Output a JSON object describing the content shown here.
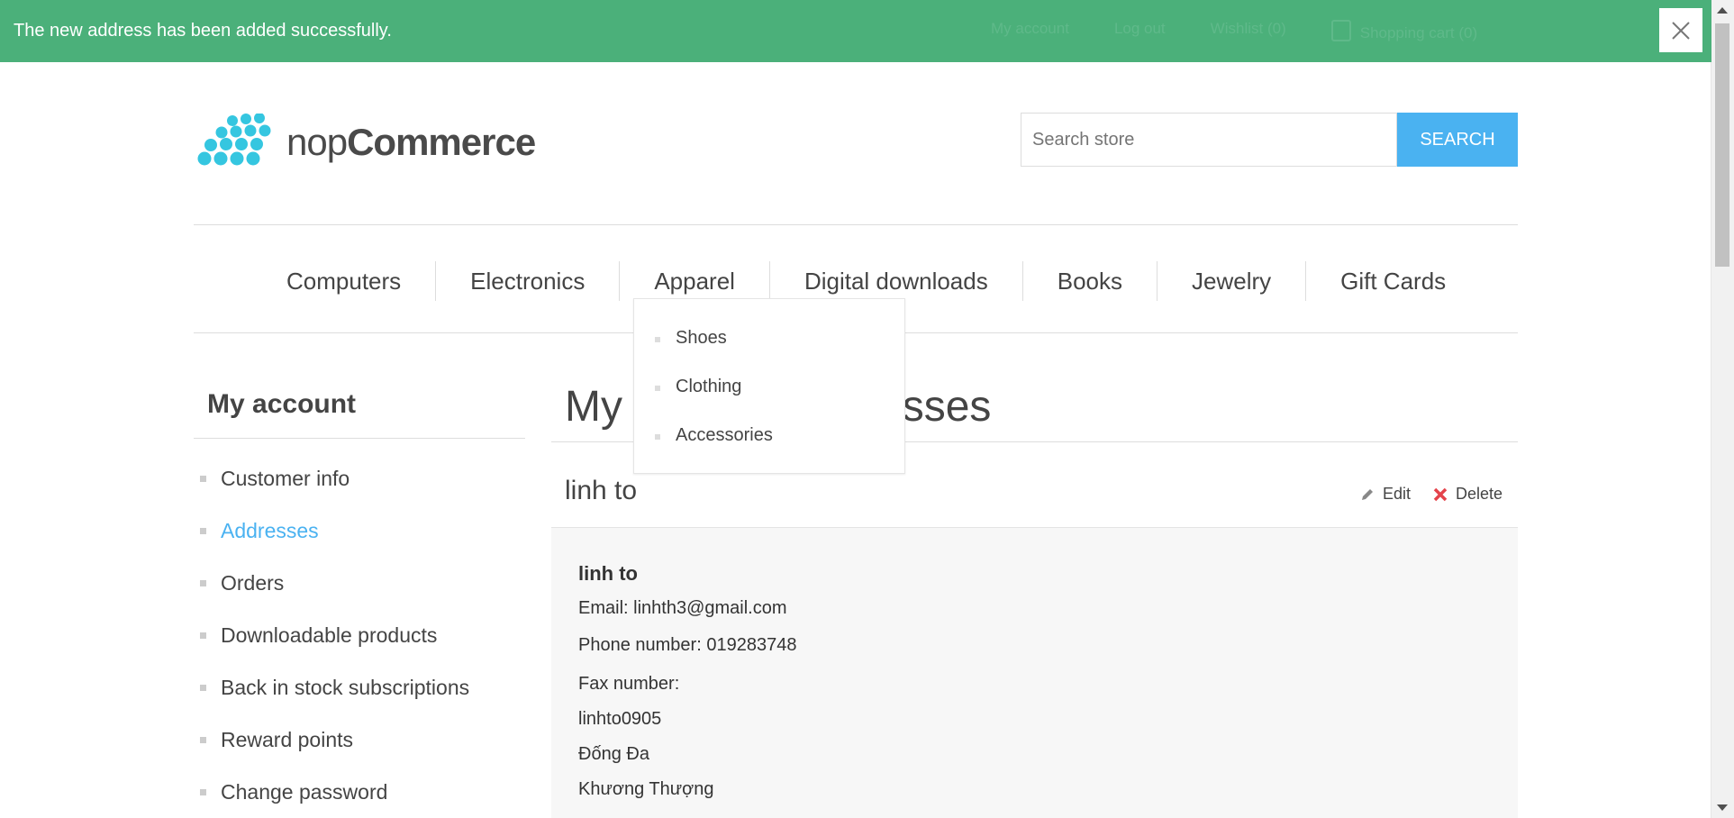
{
  "notification": {
    "message": "The new address has been added successfully."
  },
  "header_links": {
    "my_account": "My account",
    "logout": "Log out",
    "wishlist": "Wishlist (0)",
    "cart": "Shopping cart (0)"
  },
  "logo": {
    "prefix": "nop",
    "suffix": "Commerce"
  },
  "search": {
    "placeholder": "Search store",
    "button": "SEARCH"
  },
  "menu": [
    "Computers",
    "Electronics",
    "Apparel",
    "Digital downloads",
    "Books",
    "Jewelry",
    "Gift Cards"
  ],
  "apparel_dropdown": [
    "Shoes",
    "Clothing",
    "Accessories"
  ],
  "sidebar": {
    "title": "My account",
    "items": [
      "Customer info",
      "Addresses",
      "Orders",
      "Downloadable products",
      "Back in stock subscriptions",
      "Reward points",
      "Change password"
    ],
    "active": "Addresses"
  },
  "main": {
    "title_left": "My a",
    "title_right": "esses",
    "address": {
      "name": "linh to",
      "edit": "Edit",
      "delete": "Delete",
      "full_name": "linh to",
      "email_label": "Email:",
      "email": "linhth3@gmail.com",
      "phone_label": "Phone number:",
      "phone": "019283748",
      "fax_label": "Fax number:",
      "company": "linhto0905",
      "address1": "Đống Đa",
      "address2": "Khương Thượng"
    }
  },
  "colors": {
    "success": "#4bb07a",
    "accent": "#4ab2f1",
    "delete_icon": "#e4434b"
  }
}
